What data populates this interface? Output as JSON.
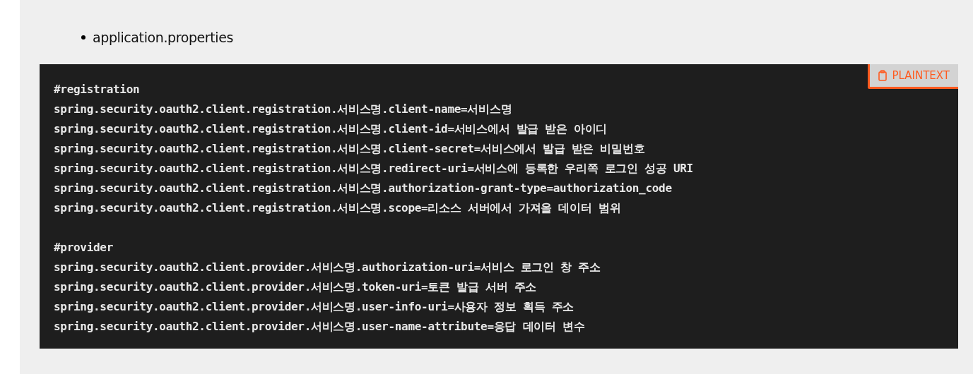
{
  "list_item": "application.properties",
  "code_block": {
    "language_button": "PLAINTEXT",
    "sections": [
      {
        "lines": [
          "#registration",
          "spring.security.oauth2.client.registration.서비스명.client-name=서비스명",
          "spring.security.oauth2.client.registration.서비스명.client-id=서비스에서 발급 받은 아이디",
          "spring.security.oauth2.client.registration.서비스명.client-secret=서비스에서 발급 받은 비밀번호",
          "spring.security.oauth2.client.registration.서비스명.redirect-uri=서비스에 등록한 우리쪽 로그인 성공 URI",
          "spring.security.oauth2.client.registration.서비스명.authorization-grant-type=authorization_code",
          "spring.security.oauth2.client.registration.서비스명.scope=리소스 서버에서 가져올 데이터 범위"
        ]
      },
      {
        "lines": [
          "#provider",
          "spring.security.oauth2.client.provider.서비스명.authorization-uri=서비스 로그인 창 주소",
          "spring.security.oauth2.client.provider.서비스명.token-uri=토큰 발급 서버 주소",
          "spring.security.oauth2.client.provider.서비스명.user-info-uri=사용자 정보 획득 주소",
          "spring.security.oauth2.client.provider.서비스명.user-name-attribute=응답 데이터 변수"
        ]
      }
    ]
  }
}
